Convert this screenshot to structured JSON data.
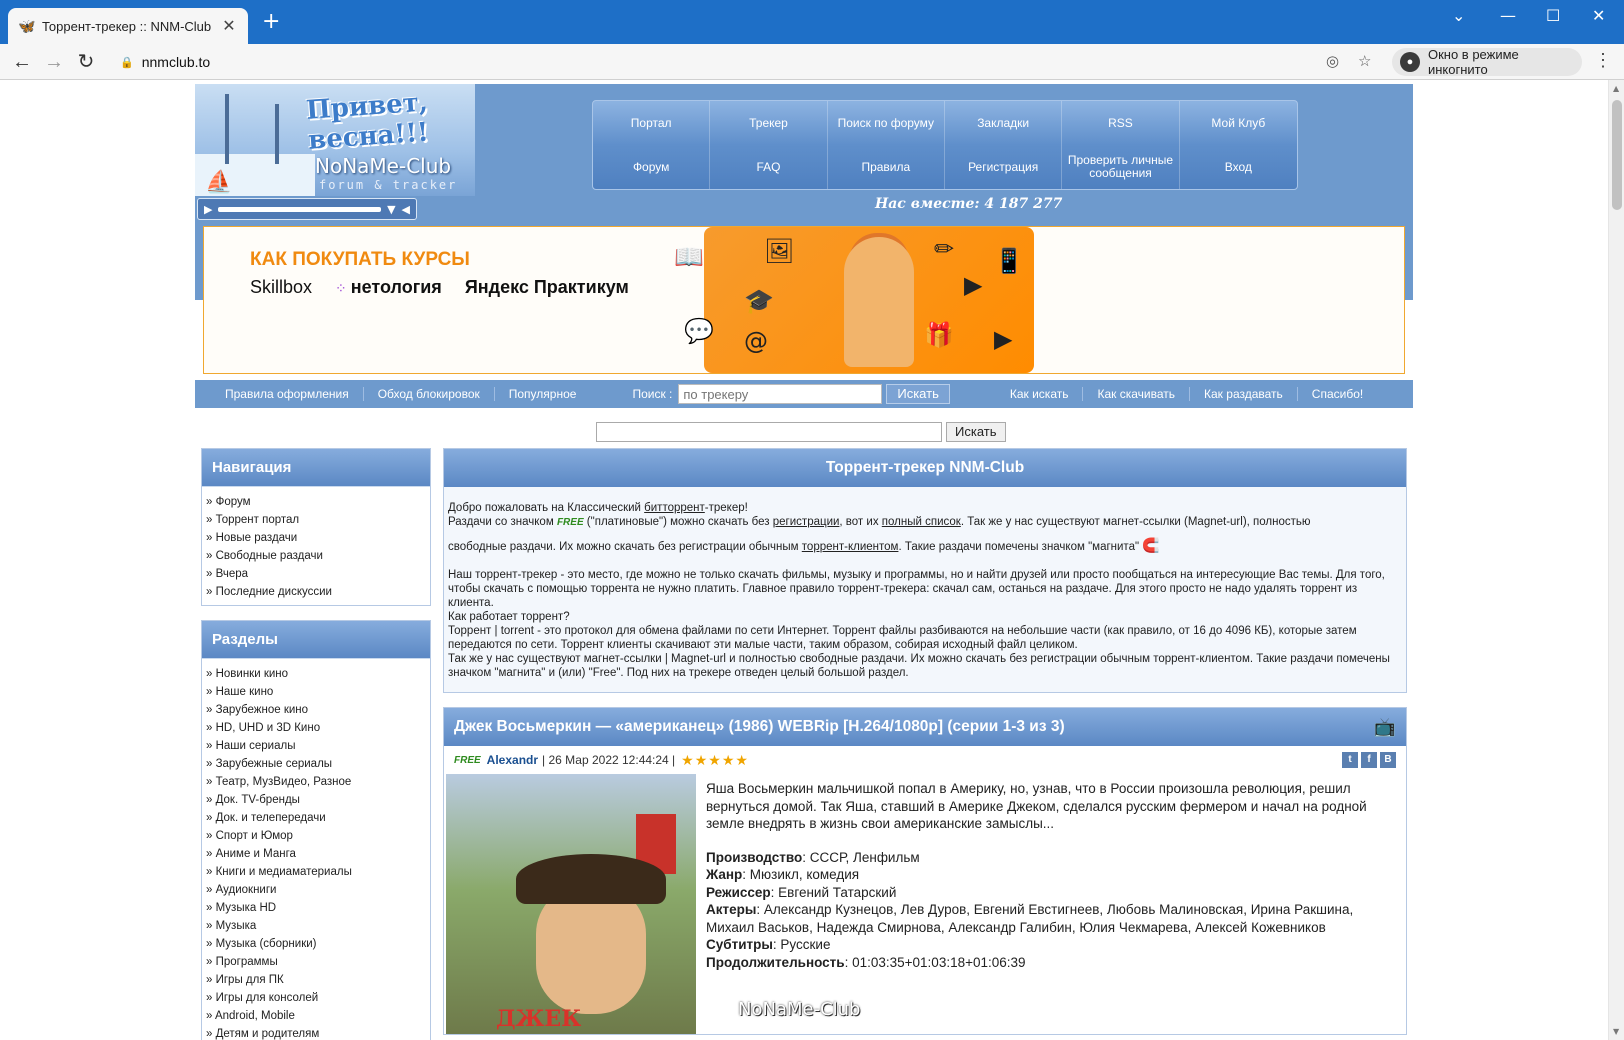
{
  "browser": {
    "tab_title": "Торрент-трекер :: NNM-Club",
    "url": "nnmclub.to",
    "incognito_label": "Окно в режиме инкогнито"
  },
  "header": {
    "logo_greeting": "Привет, весна!!!",
    "logo_brand": "NoNaMe-Club",
    "logo_sub": "forum & tracker",
    "together_text": "Нас вместе: 4 187 277",
    "nav": [
      "Портал",
      "Трекер",
      "Поиск по форуму",
      "Закладки",
      "RSS",
      "Мой Клуб",
      "Форум",
      "FAQ",
      "Правила",
      "Регистрация",
      "Проверить личные сообщения",
      "Вход"
    ]
  },
  "banner": {
    "headline": "КАК ПОКУПАТЬ КУРСЫ",
    "partners": [
      "Skillbox",
      "нетология",
      "Яндекс Практикум"
    ]
  },
  "subbar": {
    "links_left": [
      "Правила оформления",
      "Обход блокировок",
      "Популярное"
    ],
    "search_label": "Поиск :",
    "search_placeholder": "по трекеру",
    "search_button": "Искать",
    "links_right": [
      "Как искать",
      "Как скачивать",
      "Как раздавать",
      "Спасибо!"
    ]
  },
  "search2": {
    "button": "Искать"
  },
  "nav_box": {
    "title": "Навигация",
    "items": [
      "Форум",
      "Торрент портал",
      "Новые раздачи",
      "Свободные раздачи",
      "Вчера",
      "Последние дискуссии"
    ]
  },
  "sections_box": {
    "title": "Разделы",
    "items": [
      "Новинки кино",
      "Наше кино",
      "Зарубежное кино",
      "HD, UHD и 3D Кино",
      "Наши сериалы",
      "Зарубежные сериалы",
      "Театр, МузВидео, Разное",
      "Док. TV-бренды",
      "Док. и телепередачи",
      "Спорт и Юмор",
      "Аниме и Манга",
      "Книги и медиаматериалы",
      "Аудиокниги",
      "Музыка HD",
      "Музыка",
      "Музыка (сборники)",
      "Программы",
      "Игры для ПК",
      "Игры для консолей",
      "Android, Mobile",
      "Детям и родителям"
    ]
  },
  "intro": {
    "title": "Торрент-трекер NNM-Club",
    "p1a": "Добро пожаловать на Классический ",
    "p1_link": "битторрент",
    "p1b": "-трекер!",
    "p2a": "Раздачи со значком ",
    "free": "FREE",
    "p2b": " (\"платиновые\") можно скачать без ",
    "p2_link1": "регистрации",
    "p2c": ", вот их ",
    "p2_link2": "полный список",
    "p2d": ". Так же у нас существуют магнет-ссылки (Magnet-url), полностью",
    "p3a": "свободные раздачи. Их можно скачать без регистрации обычным ",
    "p3_link": "торрент-клиентом",
    "p3b": ". Такие раздачи помечены значком \"магнита\"",
    "p4": "Наш торрент-трекер - это место, где можно не только скачать фильмы, музыку и программы, но и найти друзей или просто пообщаться на интересующие Вас темы. Для того, чтобы скачать с помощью торрента не нужно платить. Главное правило торрент-трекера: скачал сам, останься на раздаче. Для этого просто не надо удалять торрент из клиента.",
    "p5": "Как работает торрент?",
    "p6": "Торрент | torrent - это протокол для обмена файлами по сети Интернет. Торрент файлы разбиваются на небольшие части (как правило, от 16 до 4096 КБ), которые затем передаются по сети. Торрент клиенты скачивают эти малые части, таким образом, собирая исходный файл целиком.",
    "p7": "Так же у нас существуют магнет-ссылки | Magnet-url и полностью свободные раздачи. Их можно скачать без регистрации обычным торрент-клиентом. Такие раздачи помечены значком \"магнита\" и (или) \"Free\". Под них на трекере отведен целый большой раздел."
  },
  "release": {
    "title": "Джек Восьмеркин — «американец» (1986) WEBRip [H.264/1080p] (серии 1-3 из 3)",
    "free": "FREE",
    "author": "Alexandr",
    "date": "| 26 Мар 2022 12:44:24 |",
    "stars": "★★★★★",
    "poster_title": "ДЖЕК",
    "summary": "Яша Восьмеркин мальчишкой попал в Америку, но, узнав, что в России произошла революция, решил вернуться домой. Так Яша, ставший в Америке Джеком, сделался русским фермером и начал на родной земле внедрять в жизнь свои американские замыслы...",
    "fields": [
      {
        "label": "Производство",
        "value": " СССР, Ленфильм"
      },
      {
        "label": "Жанр",
        "value": " Мюзикл, комедия"
      },
      {
        "label": "Режиссер",
        "value": " Евгений Татарский"
      },
      {
        "label": "Актеры",
        "value": " Александр Кузнецов, Лев Дуров, Евгений Евстигнеев, Любовь Малиновская, Ирина Ракшина, Михаил Васьков, Надежда Смирнова, Александр Галибин, Юлия Чекмарева, Алексей Кожевников"
      },
      {
        "label": "Субтитры",
        "value": " Русские"
      },
      {
        "label": "Продолжительность",
        "value": " 01:03:35+01:03:18+01:06:39"
      }
    ],
    "watermark": "NoNaMe-Club",
    "share": [
      "t",
      "f",
      "В"
    ]
  }
}
